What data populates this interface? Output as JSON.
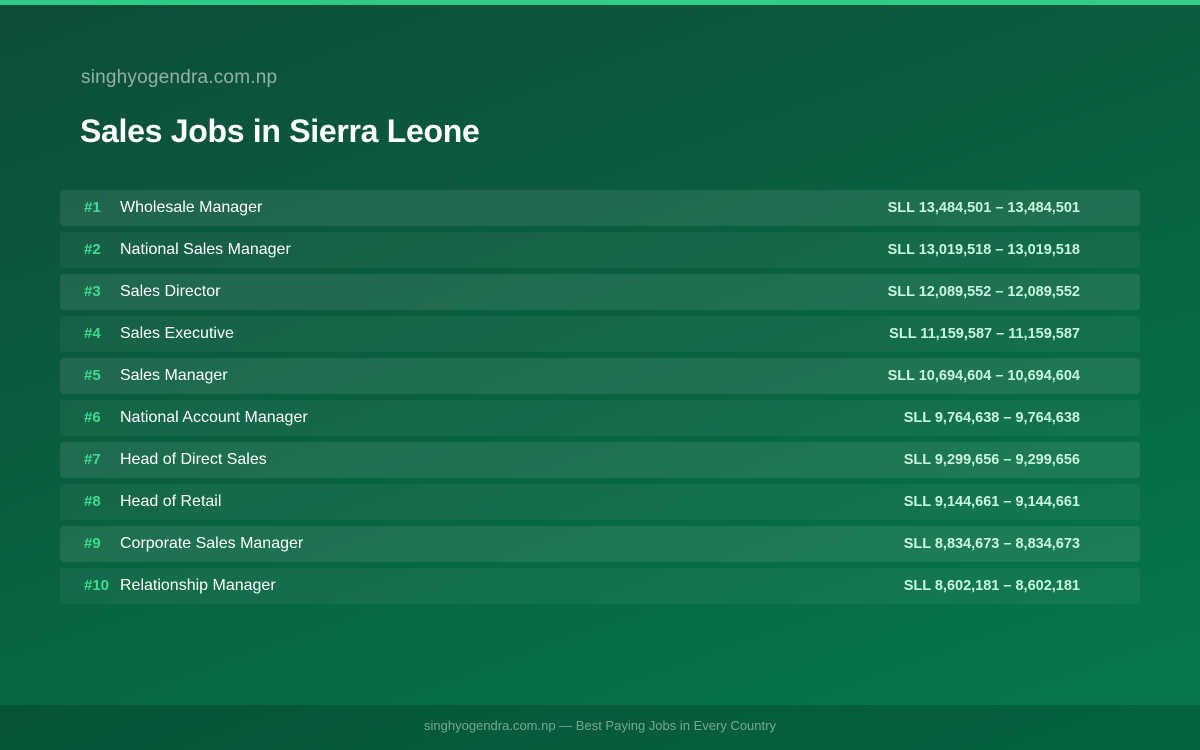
{
  "site": "singhyogendra.com.np",
  "title": "Sales Jobs in Sierra Leone",
  "jobs": [
    {
      "rank": "#1",
      "title": "Wholesale Manager",
      "salary": "SLL 13,484,501 – 13,484,501"
    },
    {
      "rank": "#2",
      "title": "National Sales Manager",
      "salary": "SLL 13,019,518 – 13,019,518"
    },
    {
      "rank": "#3",
      "title": "Sales Director",
      "salary": "SLL 12,089,552 – 12,089,552"
    },
    {
      "rank": "#4",
      "title": "Sales Executive",
      "salary": "SLL 11,159,587 – 11,159,587"
    },
    {
      "rank": "#5",
      "title": "Sales Manager",
      "salary": "SLL 10,694,604 – 10,694,604"
    },
    {
      "rank": "#6",
      "title": "National Account Manager",
      "salary": "SLL 9,764,638 – 9,764,638"
    },
    {
      "rank": "#7",
      "title": "Head of Direct Sales",
      "salary": "SLL 9,299,656 – 9,299,656"
    },
    {
      "rank": "#8",
      "title": "Head of Retail",
      "salary": "SLL 9,144,661 – 9,144,661"
    },
    {
      "rank": "#9",
      "title": "Corporate Sales Manager",
      "salary": "SLL 8,834,673 – 8,834,673"
    },
    {
      "rank": "#10",
      "title": "Relationship Manager",
      "salary": "SLL 8,602,181 – 8,602,181"
    }
  ],
  "footer": "singhyogendra.com.np — Best Paying Jobs in Every Country",
  "colors": {
    "accent": "#2ecc85",
    "rank": "#3ddc8f",
    "salary": "#c8f5dc",
    "background": "#08603f"
  }
}
